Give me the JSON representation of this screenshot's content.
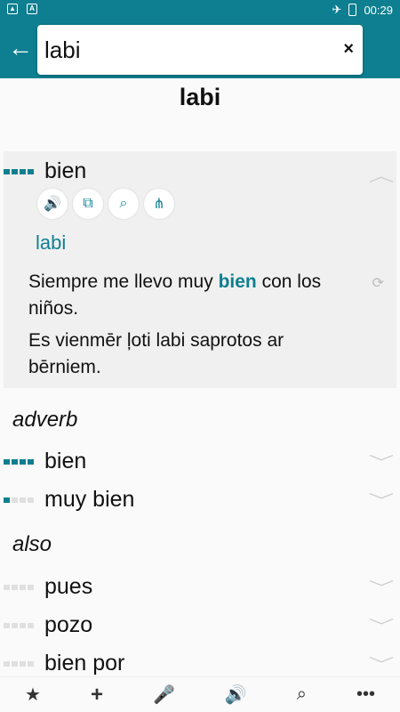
{
  "status": {
    "time": "00:29"
  },
  "search": {
    "value": "labi",
    "clear": "×"
  },
  "headword": "labi",
  "card": {
    "word": "bien",
    "translation": "labi",
    "example_pre": "Siempre me llevo muy ",
    "example_bold": "bien",
    "example_post": " con los niños.",
    "example_trans": "Es vienmēr ļoti labi saprotos ar bērniem."
  },
  "sections": [
    {
      "label": "adverb",
      "entries": [
        {
          "word": "bien",
          "level": 4
        },
        {
          "word": "muy bien",
          "level": 1
        }
      ]
    },
    {
      "label": "also",
      "entries": [
        {
          "word": "pues",
          "level": 0
        },
        {
          "word": "pozo",
          "level": 0
        },
        {
          "word": "bien por",
          "level": 0
        }
      ]
    }
  ],
  "colors": {
    "accent": "#0e7f90"
  },
  "icons": [
    "speaker-icon",
    "copy-icon",
    "search-icon",
    "share-icon"
  ],
  "bottomnav": [
    "star-icon",
    "plus-icon",
    "mic-icon",
    "speaker-icon",
    "search-icon",
    "more-icon"
  ]
}
